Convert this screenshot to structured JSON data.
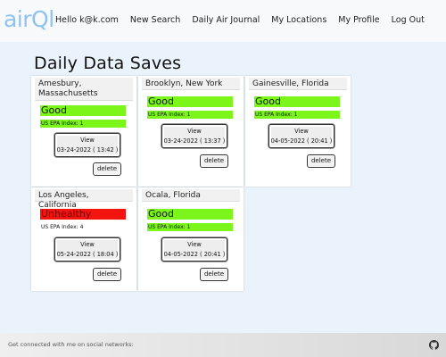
{
  "app": {
    "logo": "airQl"
  },
  "nav": {
    "items": [
      {
        "label": "Hello k@k.com"
      },
      {
        "label": "New Search"
      },
      {
        "label": "Daily Air Journal"
      },
      {
        "label": "My Locations"
      },
      {
        "label": "My Profile"
      },
      {
        "label": "Log Out"
      }
    ]
  },
  "page": {
    "title": "Daily Data Saves"
  },
  "cards": [
    {
      "location": "Amesbury, Massachusetts",
      "status": "Good",
      "epa": "US EPA Index: 1",
      "view_label": "View",
      "date": "03-24-2022 ( 13:42 )",
      "delete_label": "delete"
    },
    {
      "location": "Brooklyn, New York",
      "status": "Good",
      "epa": "US EPA Index: 1",
      "view_label": "View",
      "date": "03-24-2022 ( 13:37 )",
      "delete_label": "delete"
    },
    {
      "location": "Gainesville, Florida",
      "status": "Good",
      "epa": "US EPA Index: 1",
      "view_label": "View",
      "date": "04-05-2022 ( 20:41 )",
      "delete_label": "delete"
    },
    {
      "location": "Los Angeles, California",
      "status": "Unhealthy",
      "epa": "US EPA Index: 4",
      "view_label": "View",
      "date": "05-24-2022 ( 18:04 )",
      "delete_label": "delete"
    },
    {
      "location": "Ocala, Florida",
      "status": "Good",
      "epa": "US EPA Index: 1",
      "view_label": "View",
      "date": "04-05-2022 ( 20:41 )",
      "delete_label": "delete"
    }
  ],
  "colors": {
    "good": "#7cf51b",
    "unhealthy": "#f31410",
    "logo": "#8fc3ee",
    "background": "#eaf3fb"
  },
  "footer": {
    "text": "Get connected with me on social networks:",
    "icon": "github-icon"
  }
}
